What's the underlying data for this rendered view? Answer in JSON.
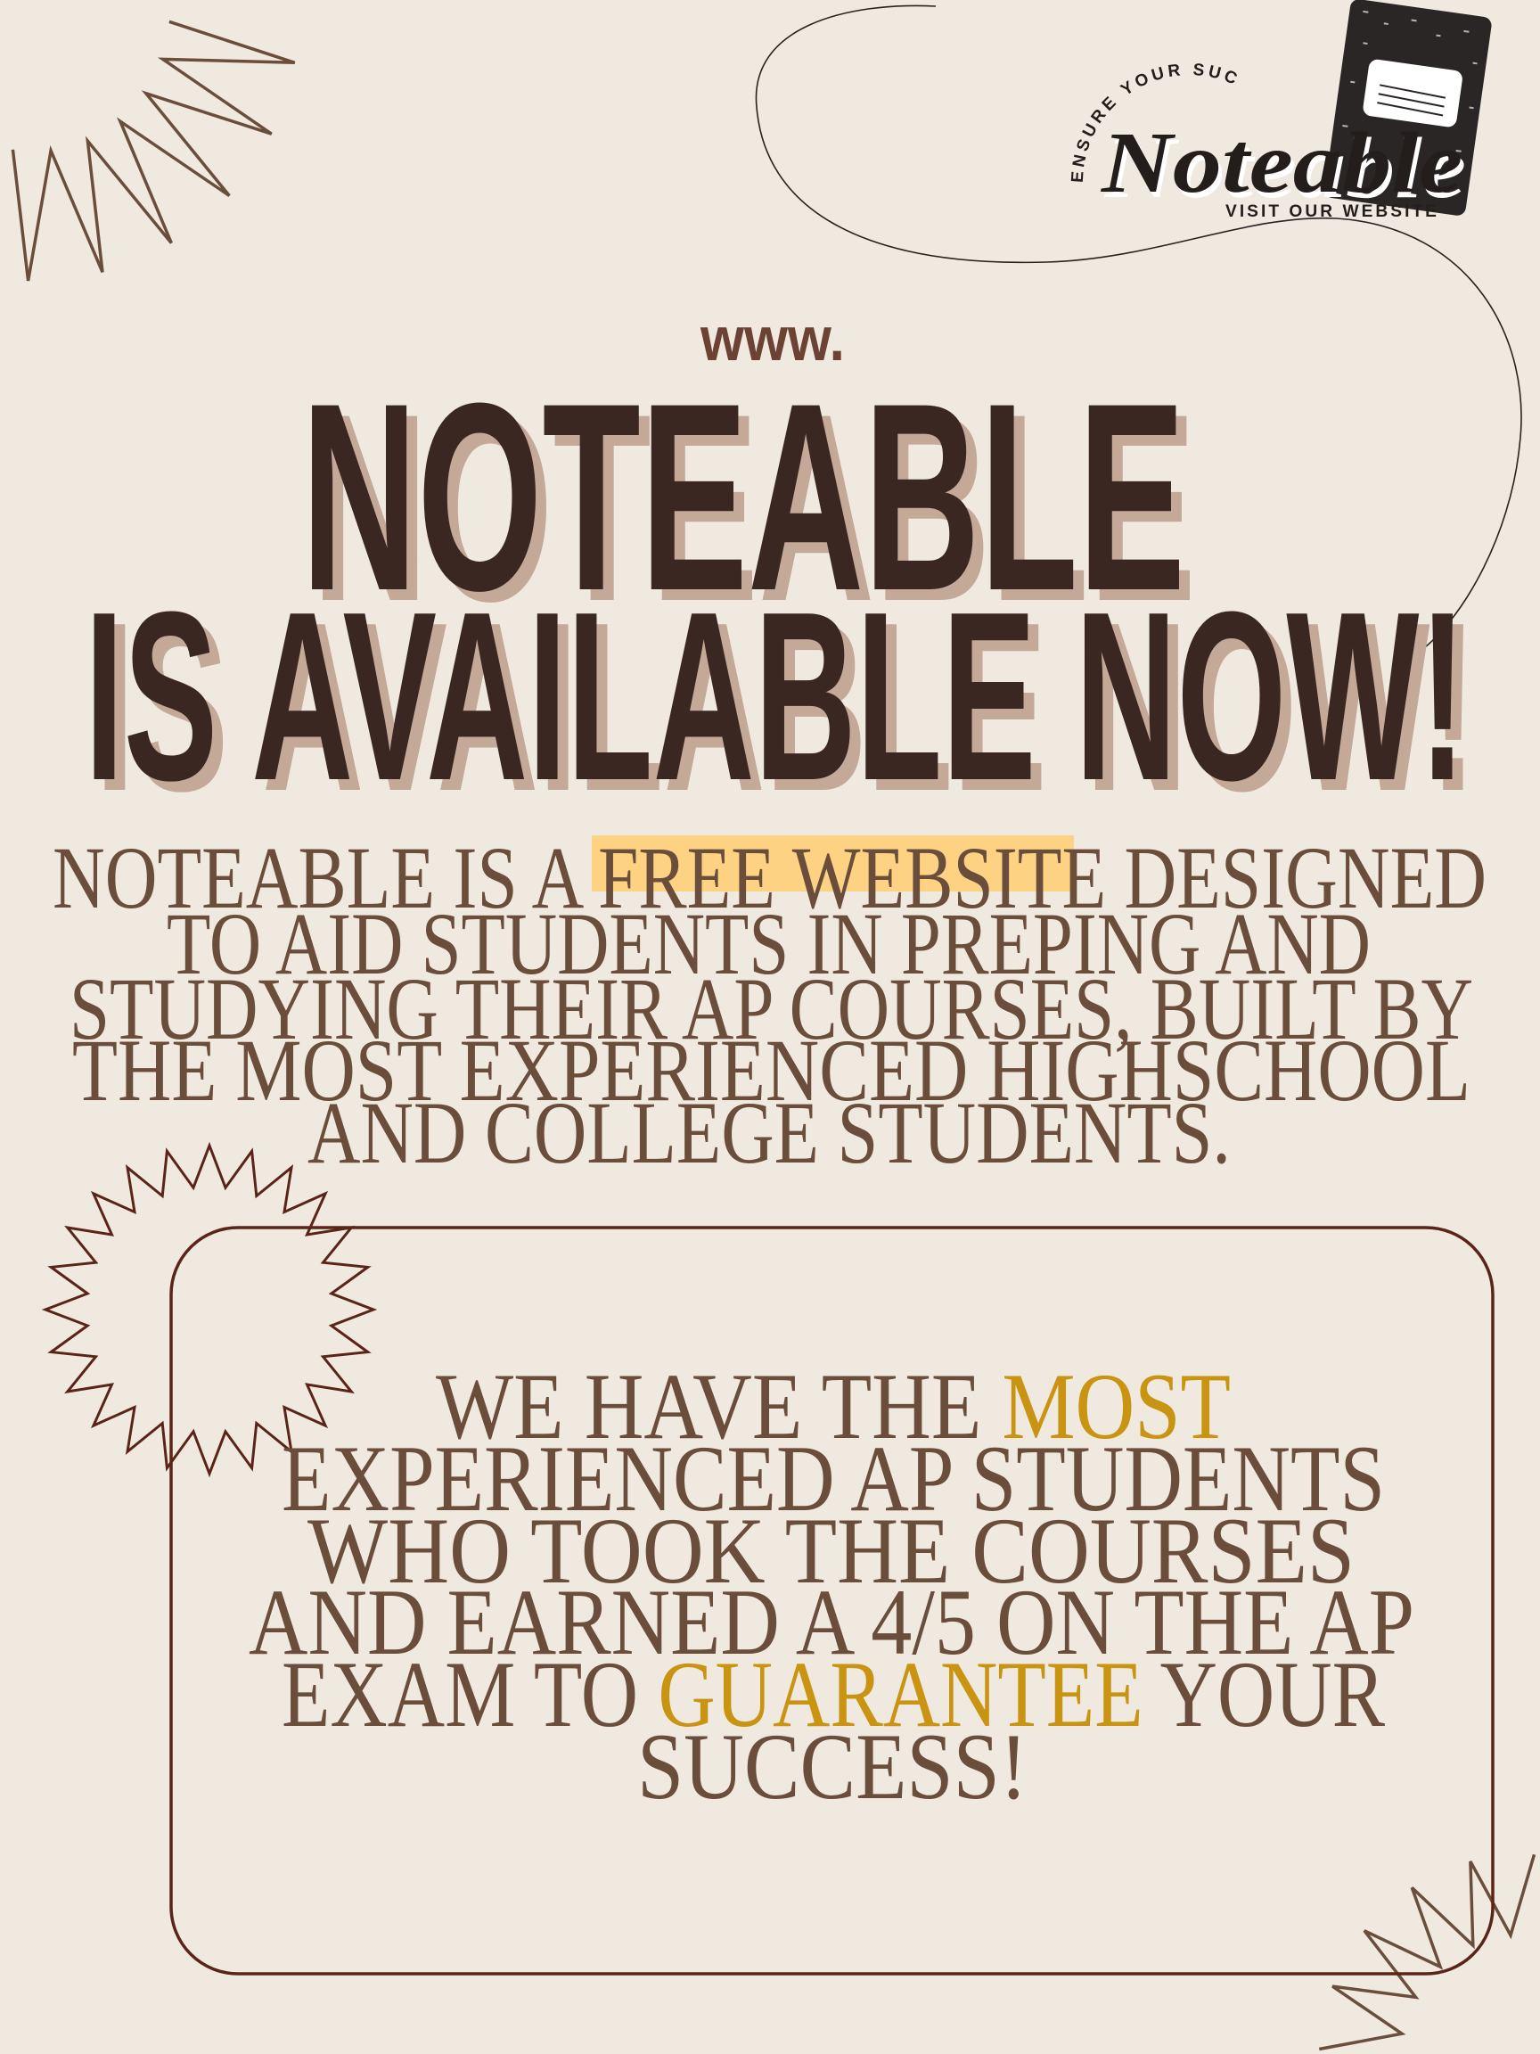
{
  "colors": {
    "background": "#f0e9e0",
    "heading": "#3a2722",
    "heading_shadow": "#c4a898",
    "body_text": "#6b4d3c",
    "accent_gold": "#c89411",
    "highlight": "#fdd283",
    "box_border": "#5a2418"
  },
  "logo": {
    "arc_text": "ENSURE YOUR SUCCESS",
    "wordmark": "Noteable",
    "subtext": "VISIT OUR WEBSITE",
    "icon": "composition-notebook-icon"
  },
  "headline": {
    "prefix": "www.",
    "line1": "NOTEABLE",
    "line2": "IS AVAILABLE NOW!"
  },
  "intro": {
    "lines": [
      {
        "before": "NOTEABLE IS A ",
        "highlight": "FREE WEBSITE",
        "after": " DESIGNED"
      },
      {
        "text": "TO AID STUDENTS IN PREPING AND"
      },
      {
        "text": "STUDYING THEIR AP COURSES, BUILT BY"
      },
      {
        "text": "THE MOST EXPERIENCED HIGHSCHOOL"
      },
      {
        "text": "AND COLLEGE STUDENTS."
      }
    ]
  },
  "callout": {
    "lines": [
      {
        "before": "WE HAVE THE ",
        "accent": "MOST",
        "after": ""
      },
      {
        "text": "EXPERIENCED AP STUDENTS"
      },
      {
        "text": "WHO TOOK THE COURSES"
      },
      {
        "text": "AND EARNED A 4/5 ON THE AP"
      },
      {
        "before": "EXAM TO ",
        "accent": "GUARANTEE",
        "after": " YOUR"
      },
      {
        "text": "SUCCESS!"
      }
    ]
  }
}
